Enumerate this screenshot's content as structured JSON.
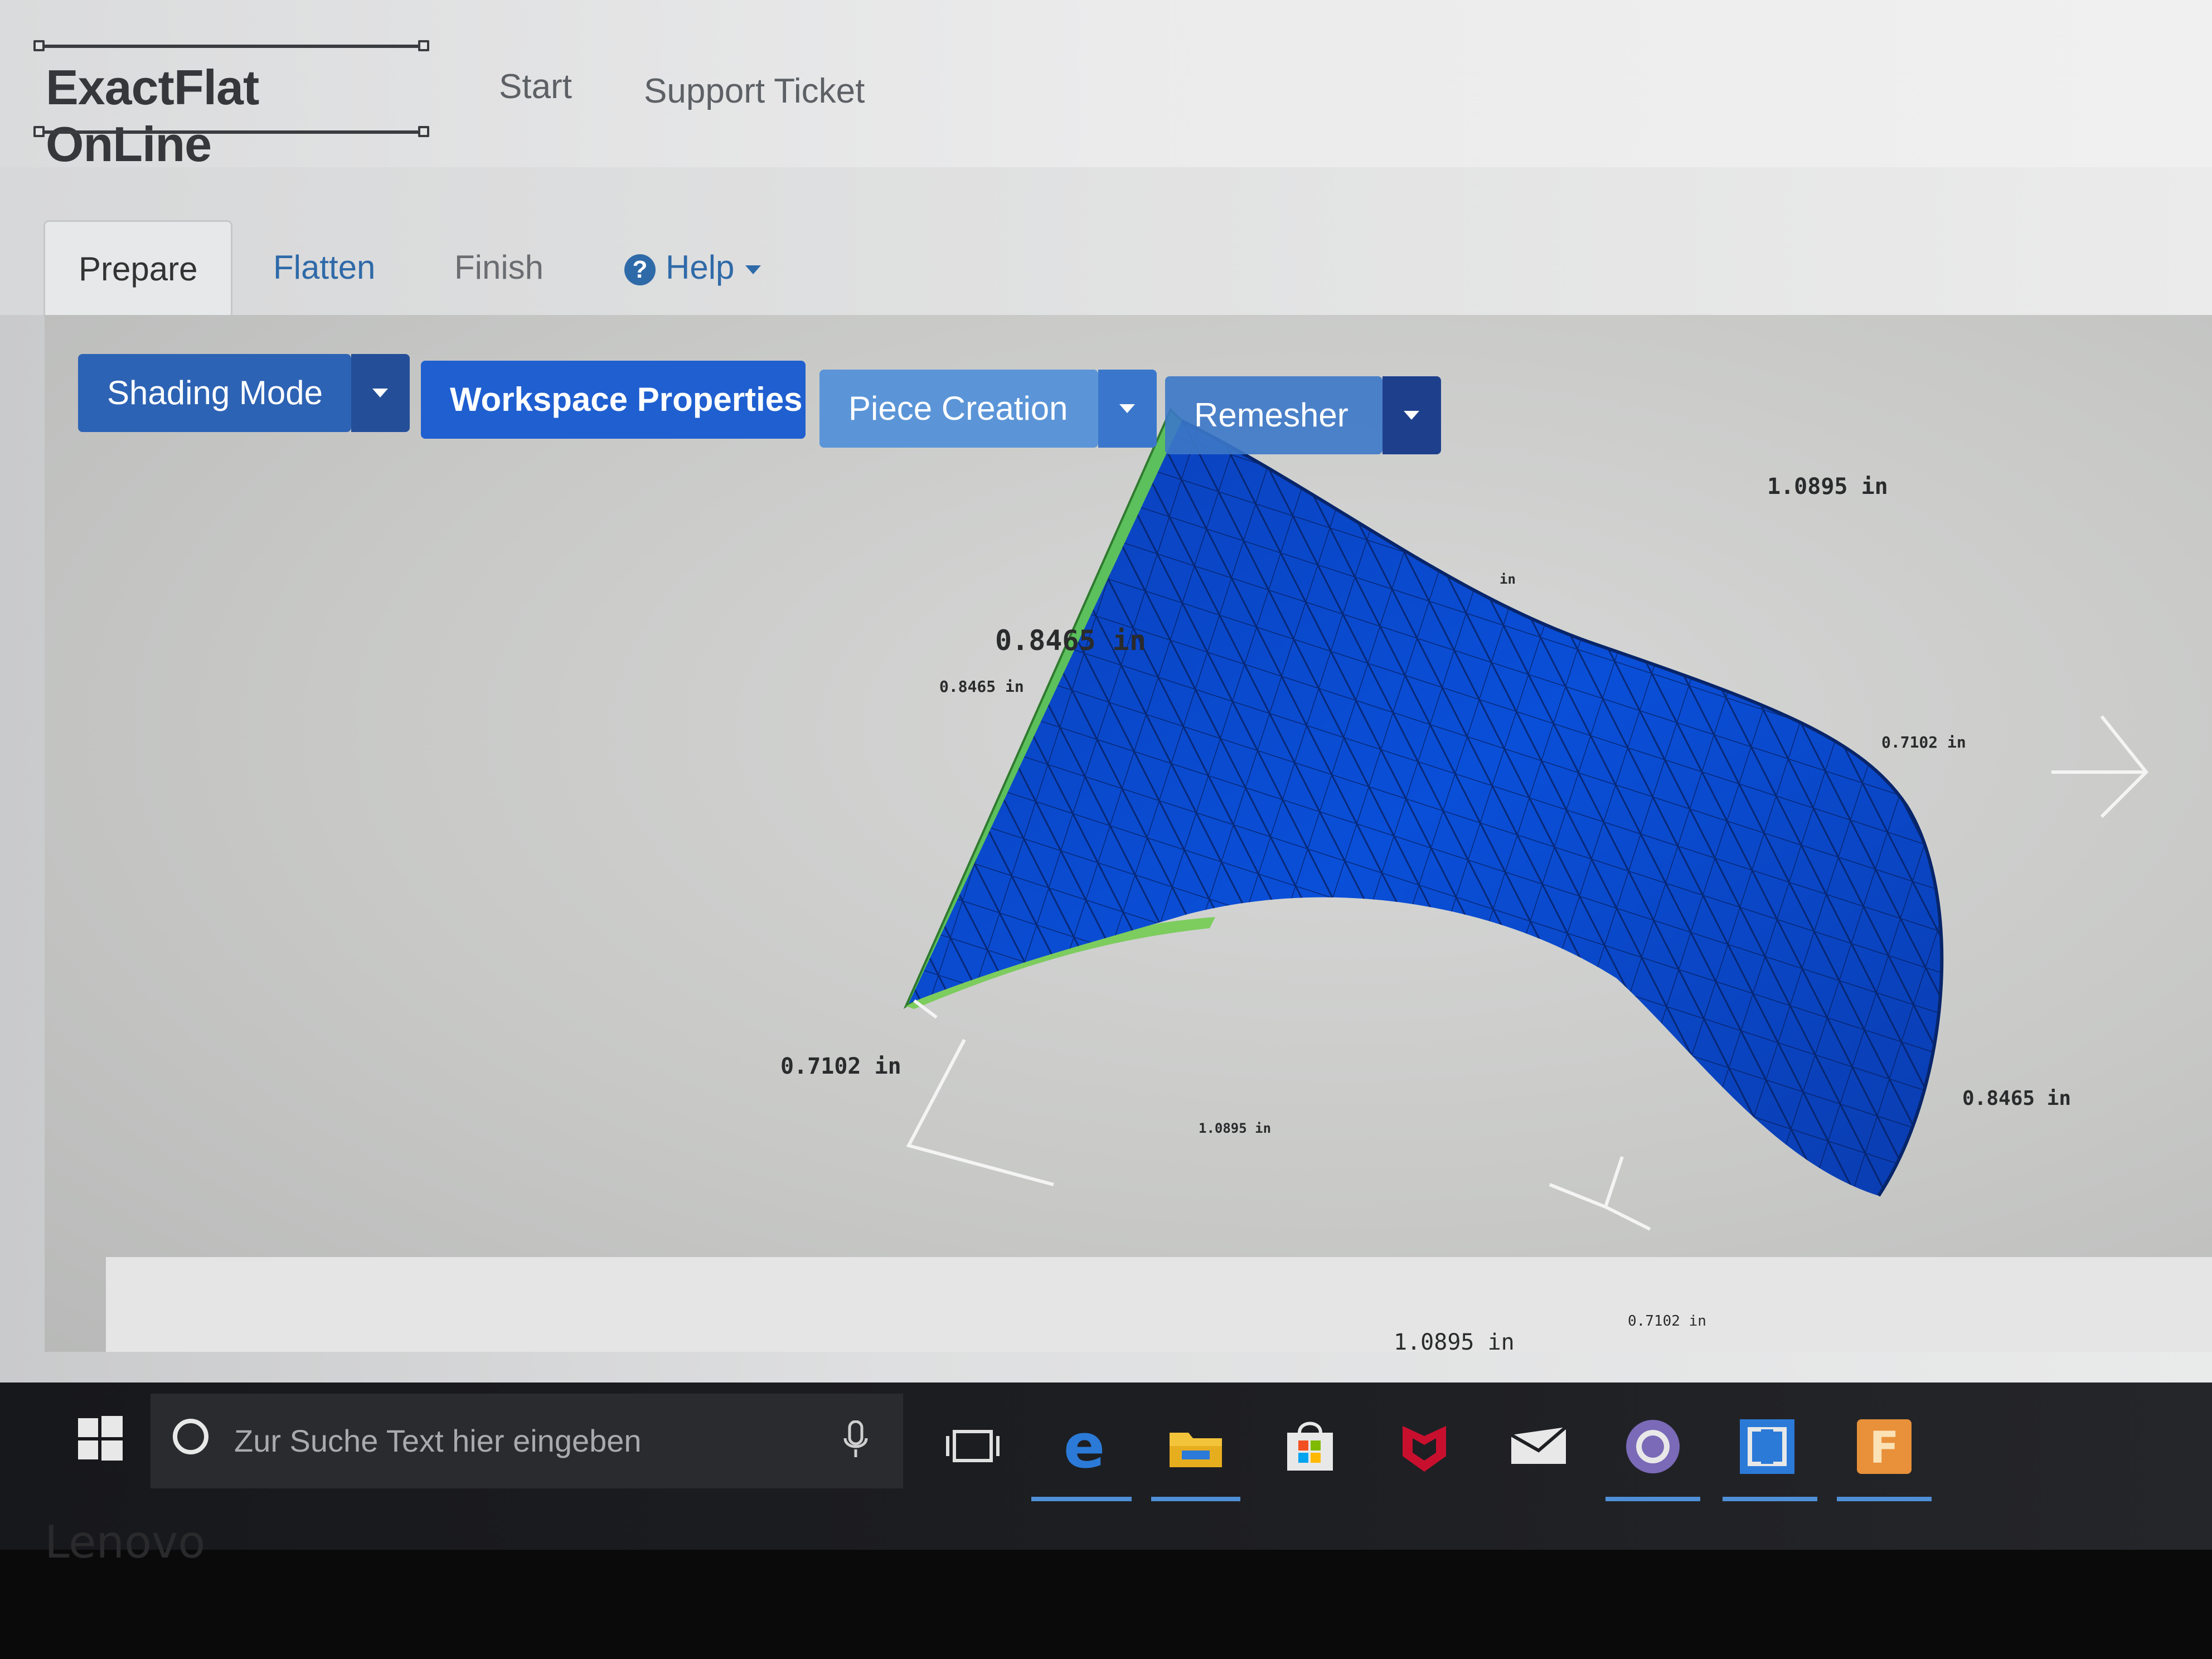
{
  "app": {
    "title": "ExactFlat OnLine",
    "nav": [
      "Start",
      "Support Ticket"
    ]
  },
  "tabs": {
    "prepare": "Prepare",
    "flatten": "Flatten",
    "finish": "Finish",
    "help": "Help"
  },
  "toolbar": {
    "shading_mode": "Shading Mode",
    "workspace_properties": "Workspace Properties",
    "piece_creation": "Piece Creation",
    "remesher": "Remesher"
  },
  "dimensions": {
    "top_right": "1.0895 in",
    "top_right_small": "in",
    "left_large": "0.8465 in",
    "left_small": "0.8465 in",
    "right_small": "0.7102 in",
    "bottom_left": "0.7102 in",
    "bottom_mid": "1.0895 in",
    "right_bottom": "0.8465 in",
    "bottom_far": "1.0895 in",
    "bottom_far_small": "0.7102 in"
  },
  "taskbar": {
    "search_placeholder": "Zur Suche Text hier eingeben",
    "icons": [
      "windows-start-icon",
      "cortana-icon",
      "microphone-icon",
      "task-view-icon",
      "edge-icon",
      "file-explorer-icon",
      "store-icon",
      "mcafee-icon",
      "mail-icon",
      "github-icon",
      "app-icon",
      "app-f-icon"
    ]
  },
  "device": {
    "brand": "Lenovo"
  },
  "colors": {
    "accent": "#2f6aa8",
    "button_dark": "#1f4fa8",
    "mesh_blue": "#0b46c9",
    "mesh_edge_green": "#5cc05c"
  }
}
